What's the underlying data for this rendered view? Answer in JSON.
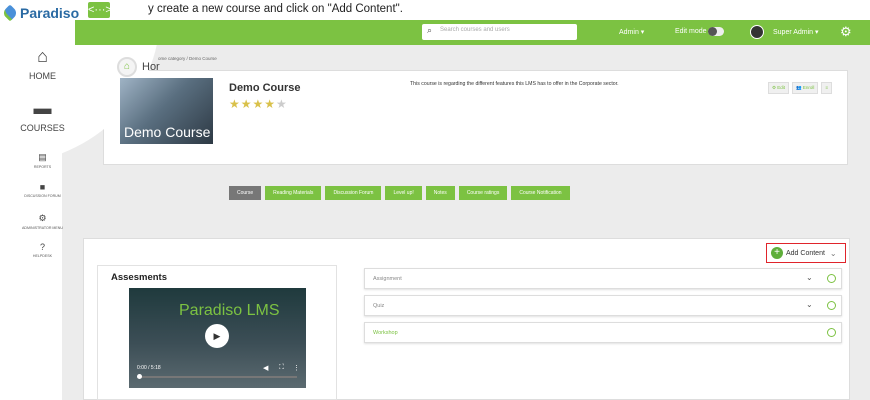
{
  "instruction": {
    "text": "y create a new course and click on \"Add Content\"."
  },
  "nav_arrows": "<···>",
  "logo": {
    "name": "Paradiso"
  },
  "header": {
    "search_placeholder": "Search courses and users",
    "admin_label": "Admin ▾",
    "edit_mode_label": "Edit mode",
    "user_label": "Super Admin ▾"
  },
  "sidebar": {
    "items": [
      {
        "label": "HOME",
        "icon": "home-icon"
      },
      {
        "label": "COURSES",
        "icon": "folder-icon"
      }
    ],
    "small_items": [
      {
        "label": "REPORTS",
        "icon": "report-icon"
      },
      {
        "label": "DISCUSSION FORUM",
        "icon": "chat-icon"
      },
      {
        "label": "ADMINISTRATOR MENU",
        "icon": "admin-gears-icon"
      },
      {
        "label": "HELPDESK",
        "icon": "help-icon"
      }
    ]
  },
  "breadcrumb": "ome category  /  Demo Course",
  "page_title": "Hor",
  "course": {
    "thumbnail_text": "Demo Course",
    "title": "Demo Course",
    "rating": {
      "value": 4,
      "max": 5
    },
    "description": "This course is regarding the different features this LMS has to offer in the Corporate sector.",
    "actions": [
      "⚙ Edit",
      "👥 Enroll",
      "≡"
    ]
  },
  "tabs": [
    {
      "label": "Course",
      "active": true
    },
    {
      "label": "Reading Materials",
      "active": false
    },
    {
      "label": "Discussion Forum",
      "active": false
    },
    {
      "label": "Level up!",
      "active": false
    },
    {
      "label": "Notes",
      "active": false
    },
    {
      "label": "Course ratings",
      "active": false
    },
    {
      "label": "Course Notification",
      "active": false
    }
  ],
  "add_content": {
    "label": "Add Content"
  },
  "assessments": {
    "heading": "Assesments",
    "video_title": "Paradiso LMS",
    "video_time": "0:00 / 5:18"
  },
  "accordion": [
    {
      "label": "Assignment",
      "has_chevron": true
    },
    {
      "label": "Quiz",
      "has_chevron": true
    },
    {
      "label": "Workshop",
      "has_chevron": false
    }
  ],
  "colors": {
    "brand_green": "#7cc242",
    "highlight_red": "#e0242b",
    "active_tab": "#777777"
  }
}
